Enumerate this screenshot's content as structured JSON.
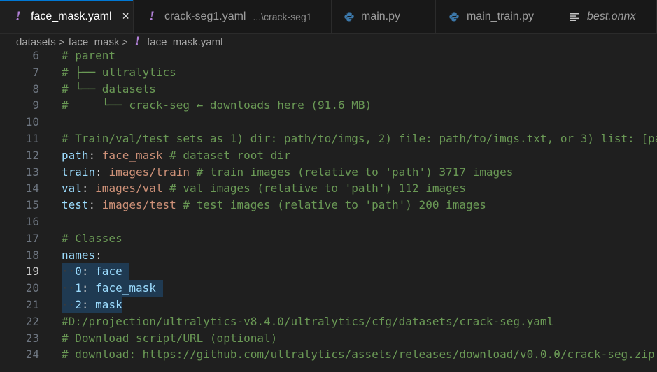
{
  "tabs": [
    {
      "label": "face_mask.yaml",
      "icon": "yaml-icon",
      "active": true,
      "close": "×"
    },
    {
      "label": "crack-seg1.yaml",
      "icon": "yaml-icon",
      "description": "...\\crack-seg1"
    },
    {
      "label": "main.py",
      "icon": "python-icon",
      "modified": true
    },
    {
      "label": "main_train.py",
      "icon": "python-icon"
    },
    {
      "label": "best.onnx",
      "icon": "file-icon",
      "preview": true
    }
  ],
  "breadcrumb": {
    "parts": [
      "datasets",
      "face_mask",
      "face_mask.yaml"
    ],
    "separator": ">"
  },
  "editor": {
    "active_line": 19,
    "lines": [
      {
        "n": "6",
        "text": "# parent"
      },
      {
        "n": "7",
        "text": "# ├── ultralytics"
      },
      {
        "n": "8",
        "text": "# └── datasets"
      },
      {
        "n": "9",
        "text": "#     └── crack-seg ← downloads here (91.6 MB)"
      },
      {
        "n": "10",
        "text": ""
      },
      {
        "n": "11",
        "text": "# Train/val/test sets as 1) dir: path/to/imgs, 2) file: path/to/imgs.txt, or 3) list: [pa"
      },
      {
        "n": "12",
        "key": "path",
        "value": "face_mask",
        "comment": "# dataset root dir"
      },
      {
        "n": "13",
        "key": "train",
        "value": "images/train",
        "comment": "# train images (relative to 'path') 3717 images"
      },
      {
        "n": "14",
        "key": "val",
        "value": "images/val",
        "comment": "# val images (relative to 'path') 112 images"
      },
      {
        "n": "15",
        "key": "test",
        "value": "images/test",
        "comment": "# test images (relative to 'path') 200 images"
      },
      {
        "n": "16",
        "text": ""
      },
      {
        "n": "17",
        "text": "# Classes"
      },
      {
        "n": "18",
        "key": "names",
        "value": "",
        "comment": ""
      },
      {
        "n": "19",
        "indent": "··",
        "key": "0",
        "value": "face"
      },
      {
        "n": "20",
        "indent": "··",
        "key": "1",
        "value": "face_mask"
      },
      {
        "n": "21",
        "indent": "··",
        "key": "2",
        "value": "mask"
      },
      {
        "n": "22",
        "text": "#D:/projection/ultralytics-v8.4.0/ultralytics/cfg/datasets/crack-seg.yaml"
      },
      {
        "n": "23",
        "text": "# Download script/URL (optional)"
      },
      {
        "n": "24",
        "text": "# download: ",
        "link": "https://github.com/ultralytics/assets/releases/download/v0.0.0/crack-seg.zip"
      }
    ]
  },
  "colors": {
    "comment": "#6a9955",
    "key": "#9cdcfe",
    "value": "#ce9178",
    "active_tab_border": "#0078d4",
    "yaml_icon": "#b180d7",
    "python_icon": "#3c78aa"
  }
}
